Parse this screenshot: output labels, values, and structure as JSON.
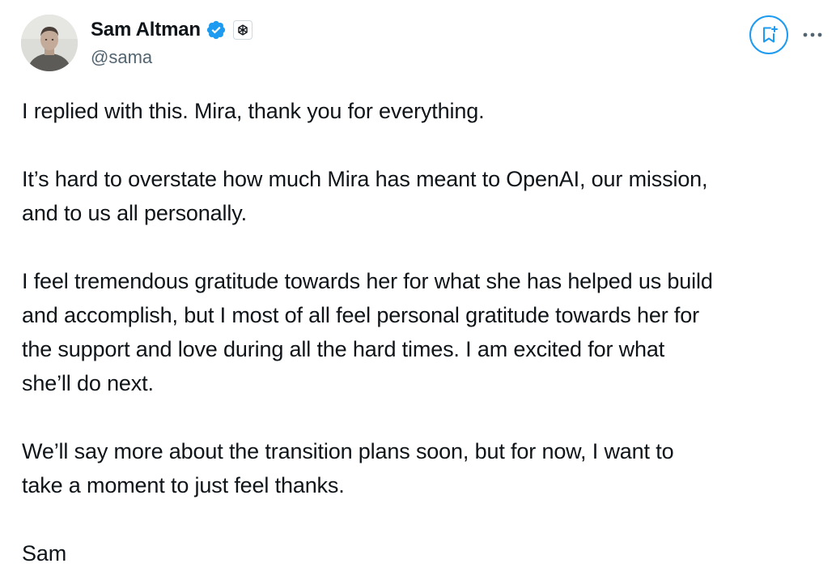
{
  "author": {
    "display_name": "Sam Altman",
    "handle": "@sama",
    "verified_badge_color": "#1d9bf0",
    "avatar_icon": "profile-photo",
    "affiliate_badge_icon": "openai-logo-icon"
  },
  "actions": {
    "grok_icon": "grok-bookmark-icon",
    "more_icon": "more-options-icon"
  },
  "post": {
    "paragraphs": [
      "I replied with this. Mira, thank you for everything.",
      "It’s hard to overstate how much Mira has meant to OpenAI, our mission,\nand to us all personally.",
      "I feel tremendous gratitude towards her for what she has helped us build\nand accomplish, but I most of all feel personal gratitude towards her for\nthe support and love during all the hard times. I am excited for what\nshe’ll do next.",
      "We’ll say more about the transition plans soon, but for now, I want to\ntake a moment to just feel thanks.",
      "Sam"
    ]
  },
  "colors": {
    "text_primary": "#0f1419",
    "text_secondary": "#536471",
    "accent": "#1d9bf0"
  }
}
